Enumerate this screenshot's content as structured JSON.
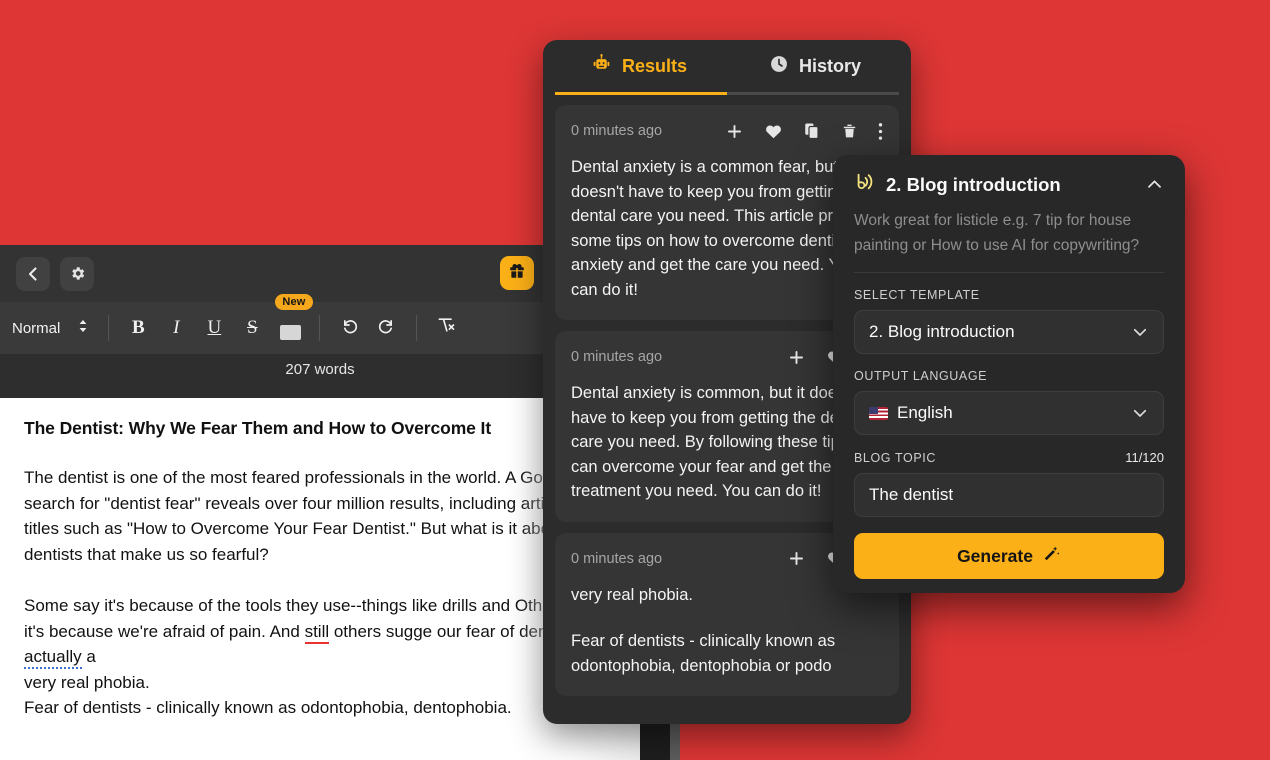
{
  "colors": {
    "background_red": "#dd3635",
    "accent_yellow": "#fcb017",
    "panel_dark": "#2c2c2c",
    "card_dark": "#353535",
    "spell_error_red": "#e8332f",
    "grammar_hint_blue": "#3b6fd4"
  },
  "editor": {
    "topbar": {
      "back_icon": "chevron-left-icon",
      "settings_icon": "gear-icon",
      "gift_icon": "gift-icon"
    },
    "toolbar": {
      "style_value": "Normal",
      "style_chevron_icon": "updown-chevron-icon",
      "bold_label": "B",
      "italic_label": "I",
      "underline_label": "U",
      "strike_label": "S",
      "highlight_icon": "highlighter-icon",
      "highlight_badge": "New",
      "undo_icon": "undo-icon",
      "redo_icon": "redo-icon",
      "clear_format_icon": "clear-formatting-icon",
      "word_count": "207 words"
    },
    "document": {
      "title": "The Dentist: Why We Fear Them and How to Overcome It",
      "para1": "The dentist is one of the most feared professionals in the world. A Google search for \"dentist fear\" reveals over four million results, including articles with titles such as \"How to Overcome Your Fear Dentist.\" But what is it about dentists that make us so fearful?",
      "para2_a": "Some say it's because of the tools they use--things like drills and Others say it's because we're afraid of pain. And ",
      "para2_spell": "still",
      "para2_b": " others sugge our fear of dentists is ",
      "para2_grammar": "actually",
      "para2_c": " a\nvery real phobia.\nFear of dentists - clinically known as odontophobia, dentophobia."
    }
  },
  "results_panel": {
    "tabs": [
      {
        "label": "Results",
        "icon": "robot-icon",
        "active": true
      },
      {
        "label": "History",
        "icon": "clock-icon",
        "active": false
      }
    ],
    "cards": [
      {
        "time": "0 minutes ago",
        "actions": [
          "plus-icon",
          "heart-icon",
          "copy-icon",
          "trash-icon",
          "more-vertical-icon"
        ],
        "text": "Dental anxiety is a common fear, but\ndoesn't have to keep you from gettin\ndental care you need. This article pro\nsome tips on how to overcome denti\nanxiety and get the care you need. Y\ncan do it!"
      },
      {
        "time": "0 minutes ago",
        "actions": [
          "plus-icon",
          "heart-icon",
          "copy-icon"
        ],
        "text": "Dental anxiety is common, but it doe\nhave to keep you from getting the de\ncare you need. By following these tip\ncan overcome your fear and get the\ntreatment you need. You can do it!"
      },
      {
        "time": "0 minutes ago",
        "actions": [
          "plus-icon",
          "heart-icon",
          "copy-icon"
        ],
        "text": "very real phobia.",
        "text2": "Fear of dentists - clinically known as\nodontophobia, dentophobia or podo"
      }
    ]
  },
  "template_popover": {
    "icon": "blog-wave-icon",
    "title": "2. Blog introduction",
    "collapse_icon": "chevron-up-icon",
    "description": "Work great for listicle e.g. 7 tip for house painting or How to use AI for copywriting?",
    "select_template_label": "SELECT TEMPLATE",
    "select_template_value": "2. Blog introduction",
    "output_language_label": "OUTPUT LANGUAGE",
    "output_language_value": "English",
    "output_language_flag": "us-flag-icon",
    "blog_topic_label": "BLOG TOPIC",
    "blog_topic_counter": "11/120",
    "blog_topic_value": "The dentist",
    "generate_label": "Generate",
    "generate_icon": "magic-wand-icon"
  }
}
